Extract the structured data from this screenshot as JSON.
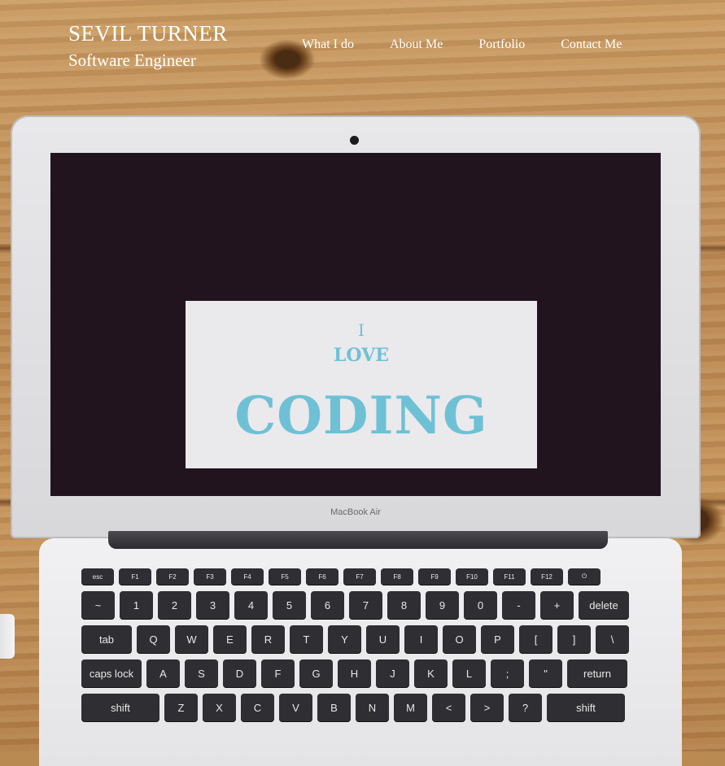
{
  "header": {
    "name": "SEVIL TURNER",
    "title": "Software Engineer",
    "nav": [
      "What I do",
      "About Me",
      "Portfolio",
      "Contact Me"
    ]
  },
  "hero": {
    "line1": "I",
    "line2": "LOVE",
    "line3": "CODING"
  },
  "laptop": {
    "model_label": "MacBook Air"
  },
  "keyboard": {
    "fn_row": [
      "esc",
      "F1",
      "F2",
      "F3",
      "F4",
      "F5",
      "F6",
      "F7",
      "F8",
      "F9",
      "F10",
      "F11",
      "F12",
      "⏻"
    ],
    "number_row": [
      "~",
      "1",
      "2",
      "3",
      "4",
      "5",
      "6",
      "7",
      "8",
      "9",
      "0",
      "-",
      "+",
      "delete"
    ],
    "q_row": [
      "tab",
      "Q",
      "W",
      "E",
      "R",
      "T",
      "Y",
      "U",
      "I",
      "O",
      "P",
      "[",
      "]",
      "\\"
    ],
    "a_row": [
      "caps lock",
      "A",
      "S",
      "D",
      "F",
      "G",
      "H",
      "J",
      "K",
      "L",
      ";",
      "\"",
      "return"
    ],
    "z_row": [
      "shift",
      "Z",
      "X",
      "C",
      "V",
      "B",
      "N",
      "M",
      "<",
      ">",
      "?",
      "shift"
    ]
  },
  "colors": {
    "accent": "#6ec1d5",
    "screen": "#22141f",
    "hero_bg": "#eae9ec",
    "nav_text": "#ffffff"
  }
}
